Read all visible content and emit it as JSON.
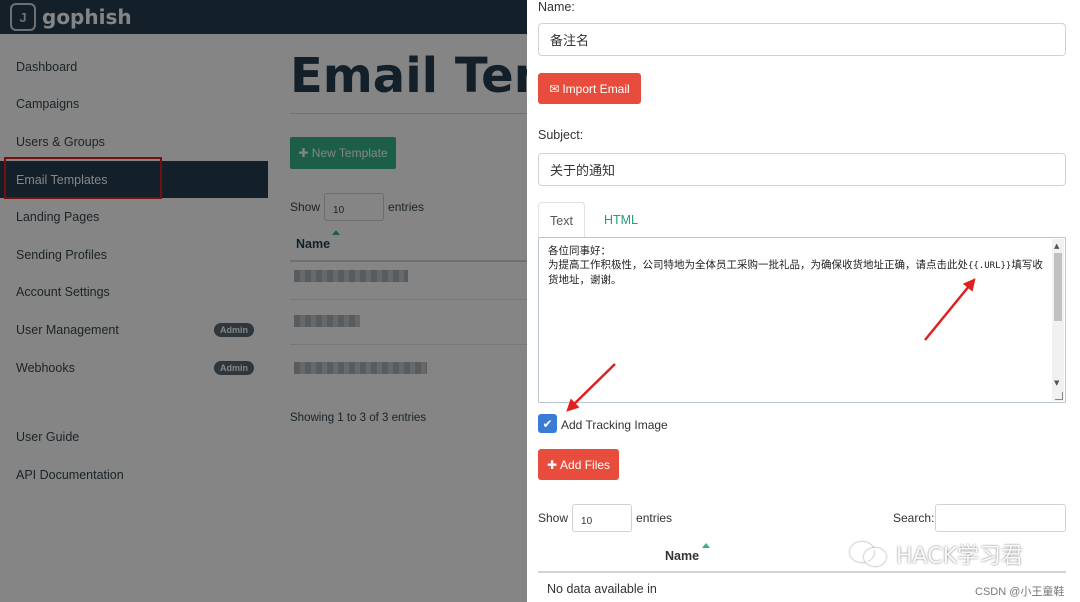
{
  "app": {
    "logo_letter": "J",
    "logo_text": "gophish"
  },
  "sidebar": {
    "items": [
      {
        "label": "Dashboard"
      },
      {
        "label": "Campaigns"
      },
      {
        "label": "Users & Groups"
      },
      {
        "label": "Email Templates"
      },
      {
        "label": "Landing Pages"
      },
      {
        "label": "Sending Profiles"
      },
      {
        "label": "Account Settings"
      },
      {
        "label": "User Management",
        "badge": "Admin"
      },
      {
        "label": "Webhooks",
        "badge": "Admin"
      }
    ],
    "footer_items": [
      {
        "label": "User Guide"
      },
      {
        "label": "API Documentation"
      }
    ]
  },
  "main": {
    "title": "Email Templ",
    "new_button": "New Template",
    "show_label": "Show",
    "entries_value": "10",
    "entries_label": "entries",
    "column_name": "Name",
    "showing_text": "Showing 1 to 3 of 3 entries"
  },
  "modal": {
    "name_label": "Name:",
    "name_value": "备注名",
    "import_button": "Import Email",
    "subject_label": "Subject:",
    "subject_value": "关于的通知",
    "tabs": [
      {
        "label": "Text"
      },
      {
        "label": "HTML"
      }
    ],
    "body_line1": "各位同事好：",
    "body_line2_pre": "为提高工作积极性，公司特地为全体员工采购一批礼品，为确保收货地址正确，请点击此处",
    "body_url_token": "{{.URL}}",
    "body_line2_post": "填写收货地址，谢谢。",
    "tracking_label": "Add Tracking Image",
    "add_files_button": "Add Files",
    "show_label": "Show",
    "entries_value": "10",
    "entries_label": "entries",
    "search_label": "Search:",
    "column_name": "Name",
    "no_data": "No data available in"
  },
  "watermark": {
    "text": "HACK学习君",
    "credit": "CSDN @小王童鞋"
  },
  "colors": {
    "navbar": "#283f50",
    "accent_green": "#37b48a",
    "danger_red": "#e74c3c",
    "checkbox_blue": "#3a7bd5",
    "annotation_red": "#e02020"
  }
}
